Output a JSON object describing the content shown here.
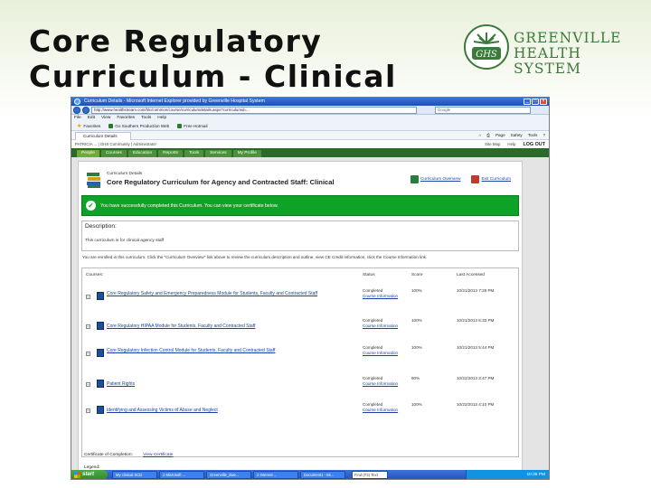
{
  "slide": {
    "title": "Core Regulatory\nCurriculum - Clinical",
    "logo_text": "GREENVILLE\nHEALTH SYSTEM",
    "logo_badge": "GHS",
    "brand_color": "#3b7a3a"
  },
  "browser": {
    "window_title": "Curriculum Details - Microsoft Internet Explorer provided by Greenville Hospital System",
    "address": "http://www.healthstream.com/hlc/common/course/curriculumdetails.aspx?curriculumid=...",
    "search_placeholder": "Google",
    "menu": [
      "File",
      "Edit",
      "View",
      "Favorites",
      "Tools",
      "Help"
    ],
    "favorites": [
      "Favorites",
      "Go Southern Production Web",
      "Free Hotmail"
    ],
    "tab_label": "Curriculum Details",
    "command_bar": [
      "Page",
      "Safety",
      "Tools"
    ]
  },
  "site": {
    "user_line": "PATRICIA ... | GHS Community | Administrator",
    "header_links": [
      "Site Map",
      "Help",
      "LOG OUT"
    ],
    "nav_tabs": [
      "People",
      "Courses",
      "Education",
      "Reports",
      "Tools",
      "Services",
      "My Profile"
    ]
  },
  "curriculum": {
    "small_label": "Curriculum Details",
    "title": "Core Regulatory Curriculum for Agency and Contracted Staff: Clinical",
    "links": [
      "Curriculum Overview",
      "Exit Curriculum"
    ],
    "success_message": "You have successfully completed this Curriculum. You can view your certificate below.",
    "description_label": "Description:",
    "description_text": "This curriculum is for clinical agency staff",
    "instructions": "You are enrolled in this curriculum. Click the \"Curriculum Overview\" link above to review the curriculum description and outline, view CE Credit information, click the Course Information link.",
    "columns": [
      "Courses:",
      "Status",
      "Score",
      "Last Accessed"
    ],
    "courses": [
      {
        "name": "Core Regulatory Safety and Emergency Preparedness Module for Students, Faculty and Contracted Staff",
        "status": "Completed",
        "info": "Course Information",
        "score": "100%",
        "date": "10/21/2013 7:29 PM"
      },
      {
        "name": "Core Regulatory HIPAA Module for Students, Faculty and Contracted Staff",
        "status": "Completed",
        "info": "Course Information",
        "score": "100%",
        "date": "10/21/2013 5:33 PM"
      },
      {
        "name": "Core Regulatory Infection Control Module for Students, Faculty and Contracted Staff",
        "status": "Completed",
        "info": "Course Information",
        "score": "100%",
        "date": "10/21/2013 5:44 PM"
      },
      {
        "name": "Patient Rights",
        "status": "Completed",
        "info": "Course Information",
        "score": "90%",
        "date": "10/22/2013 3:47 PM"
      },
      {
        "name": "Identifying and Assessing Victims of Abuse and Neglect",
        "status": "Completed",
        "info": "Course Information",
        "score": "100%",
        "date": "10/22/2013 4:10 PM"
      }
    ],
    "certificate_label": "Certificate of Completion:",
    "certificate_link": "View Certificate",
    "legend_label": "Legend:"
  },
  "taskbar": {
    "start": "start",
    "items": [
      "My clinical SCD",
      "2 Microsoft ...",
      "Greenville_dwe...",
      "2 Internet ...",
      "Document1 - Mi..."
    ],
    "search": "Find (F3) Text",
    "clock": "10:36 PM"
  }
}
